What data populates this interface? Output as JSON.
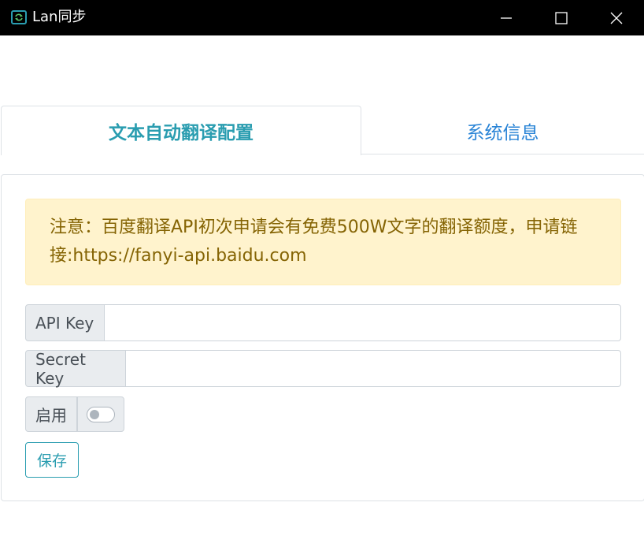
{
  "window": {
    "title": "Lan同步",
    "app_icon": "sync-icon",
    "controls": [
      "minimize-icon",
      "maximize-icon",
      "close-icon"
    ]
  },
  "tabs": [
    {
      "label": "文本自动翻译配置",
      "active": true
    },
    {
      "label": "系统信息",
      "active": false
    }
  ],
  "alert": {
    "text": "注意：百度翻译API初次申请会有免费500W文字的翻译额度，申请链接:https://fanyi-api.baidu.com"
  },
  "form": {
    "api_key_label": "API Key",
    "api_key_value": "",
    "secret_key_label": "Secret Key",
    "secret_key_value": "",
    "enable_label": "启用",
    "enable_checked": false,
    "save_label": "保存"
  },
  "colors": {
    "titlebar": "#000000",
    "accent": "#2a9db0",
    "tab_link": "#2a84d6",
    "alert_bg": "#fff3cd",
    "alert_text": "#856404"
  }
}
